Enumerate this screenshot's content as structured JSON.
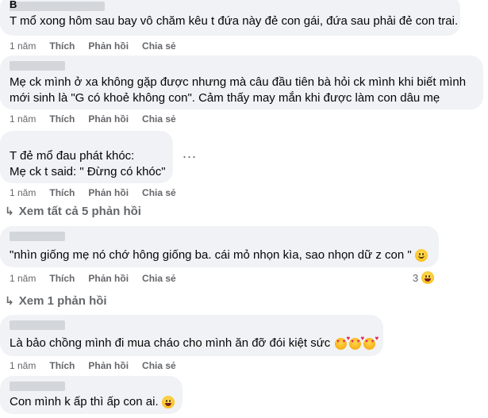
{
  "comments": [
    {
      "text_lines": [
        "T mổ xong hôm sau bay vô chăm kêu t đứa này đẻ con gái, đứa sau phải đẻ con trai."
      ],
      "author_initial": "B"
    },
    {
      "text_lines": [
        "Mẹ ck mình ở xa không gặp được nhưng mà câu đầu tiên bà hỏi ck mình khi biết mình",
        "mới sinh là \"G có khoẻ không con\". Cảm thấy may mắn khi được làm con dâu mẹ"
      ]
    },
    {
      "text_lines": [
        "T đẻ mổ đau phát khóc:",
        "Mẹ ck t said: \" Đừng có khóc\""
      ]
    },
    {
      "text_lines": [
        "\"nhìn giống mẹ nó chớ hông giống ba. cái mỏ nhọn kìa, sao nhọn dữ z con \""
      ],
      "reaction_count": "3"
    },
    {
      "text_lines": [
        "Là bảo chồng mình đi mua cháo cho mình ăn đỡ đói kiệt sức"
      ]
    },
    {
      "text_lines": [
        "Con mình k ấp thì ấp con ai."
      ]
    }
  ],
  "actions": {
    "time": "1 năm",
    "like": "Thích",
    "reply": "Phản hồi",
    "share": "Chia sẻ"
  },
  "view_replies": {
    "first": "Xem tất cả 5 phản hồi",
    "second": "Xem 1 phản hồi"
  },
  "more_options": "...",
  "icons": [
    "smile-emoji-icon",
    "laughing-emoji-icon",
    "heart-eyes-emoji-icon",
    "tears-of-joy-emoji-icon",
    "reply-arrow-icon",
    "more-options-icon"
  ]
}
